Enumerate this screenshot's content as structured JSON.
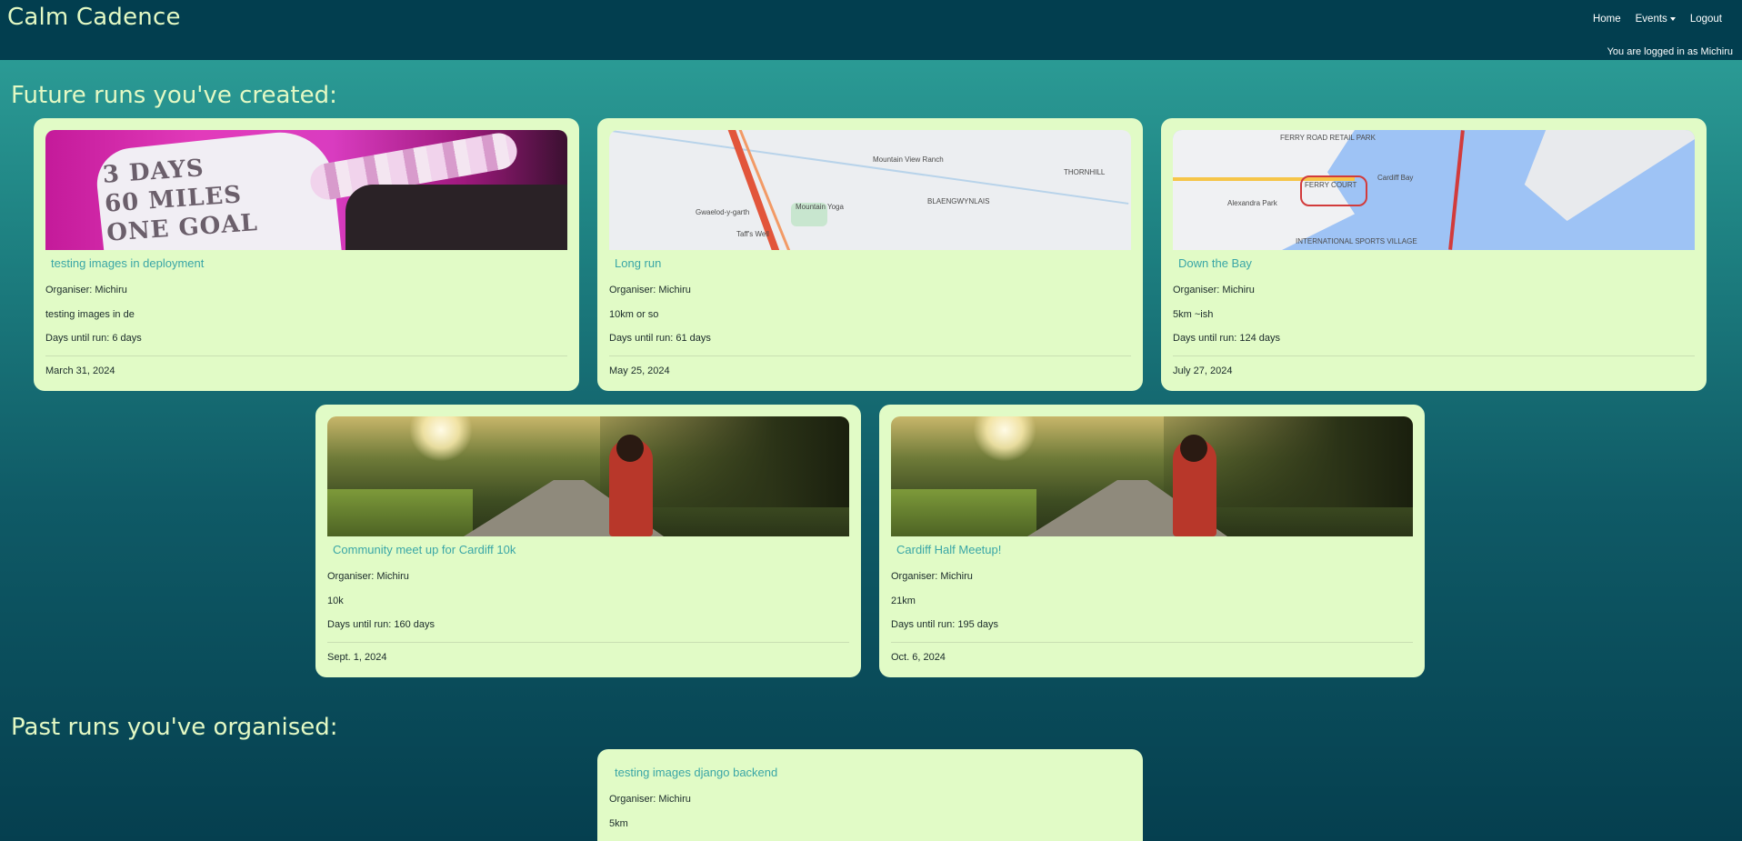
{
  "navbar": {
    "brand": "Calm Cadence",
    "links": {
      "home": "Home",
      "events": "Events",
      "logout": "Logout"
    },
    "login_status": "You are logged in as Michiru"
  },
  "future_section": {
    "heading": "Future runs you've created:",
    "cards": [
      {
        "title": "testing images in deployment",
        "organiser": "Organiser: Michiru",
        "description": "testing images in de",
        "days_until": "Days until run: 6 days",
        "date": "March 31, 2024",
        "image": "event-photo"
      },
      {
        "title": "Long run",
        "organiser": "Organiser: Michiru",
        "description": "10km or so",
        "days_until": "Days until run: 61 days",
        "date": "May 25, 2024",
        "image": "route-map",
        "map_labels": [
          "Mountain View Ranch",
          "Mountain Yoga",
          "BLAENGWYNLAIS",
          "Gwaelod-y-garth",
          "Taff's Well",
          "THORNHILL"
        ]
      },
      {
        "title": "Down the Bay",
        "organiser": "Organiser: Michiru",
        "description": "5km ~ish",
        "days_until": "Days until run: 124 days",
        "date": "July 27, 2024",
        "image": "route-map",
        "map_labels": [
          "FERRY ROAD RETAIL PARK",
          "FERRY COURT",
          "Alexandra Park",
          "Cardiff Bay",
          "INTERNATIONAL SPORTS VILLAGE"
        ]
      },
      {
        "title": "Community meet up for Cardiff 10k",
        "organiser": "Organiser: Michiru",
        "description": "10k",
        "days_until": "Days until run: 160 days",
        "date": "Sept. 1, 2024",
        "image": "runner-path-photo"
      },
      {
        "title": "Cardiff Half Meetup!",
        "organiser": "Organiser: Michiru",
        "description": "21km",
        "days_until": "Days until run: 195 days",
        "date": "Oct. 6, 2024",
        "image": "runner-path-photo"
      }
    ]
  },
  "past_section": {
    "heading": "Past runs you've organised:",
    "cards": [
      {
        "title": "testing images django backend",
        "organiser": "Organiser: Michiru",
        "description": "5km"
      }
    ]
  },
  "jacket_text": [
    "3 DAYS",
    "60 MILES",
    "ONE GOAL"
  ],
  "colors": {
    "navbar": "#023e4f",
    "brand_text": "#e3f9c4",
    "card_bg": "#e1fbc6",
    "card_title": "#3aa6a6"
  }
}
